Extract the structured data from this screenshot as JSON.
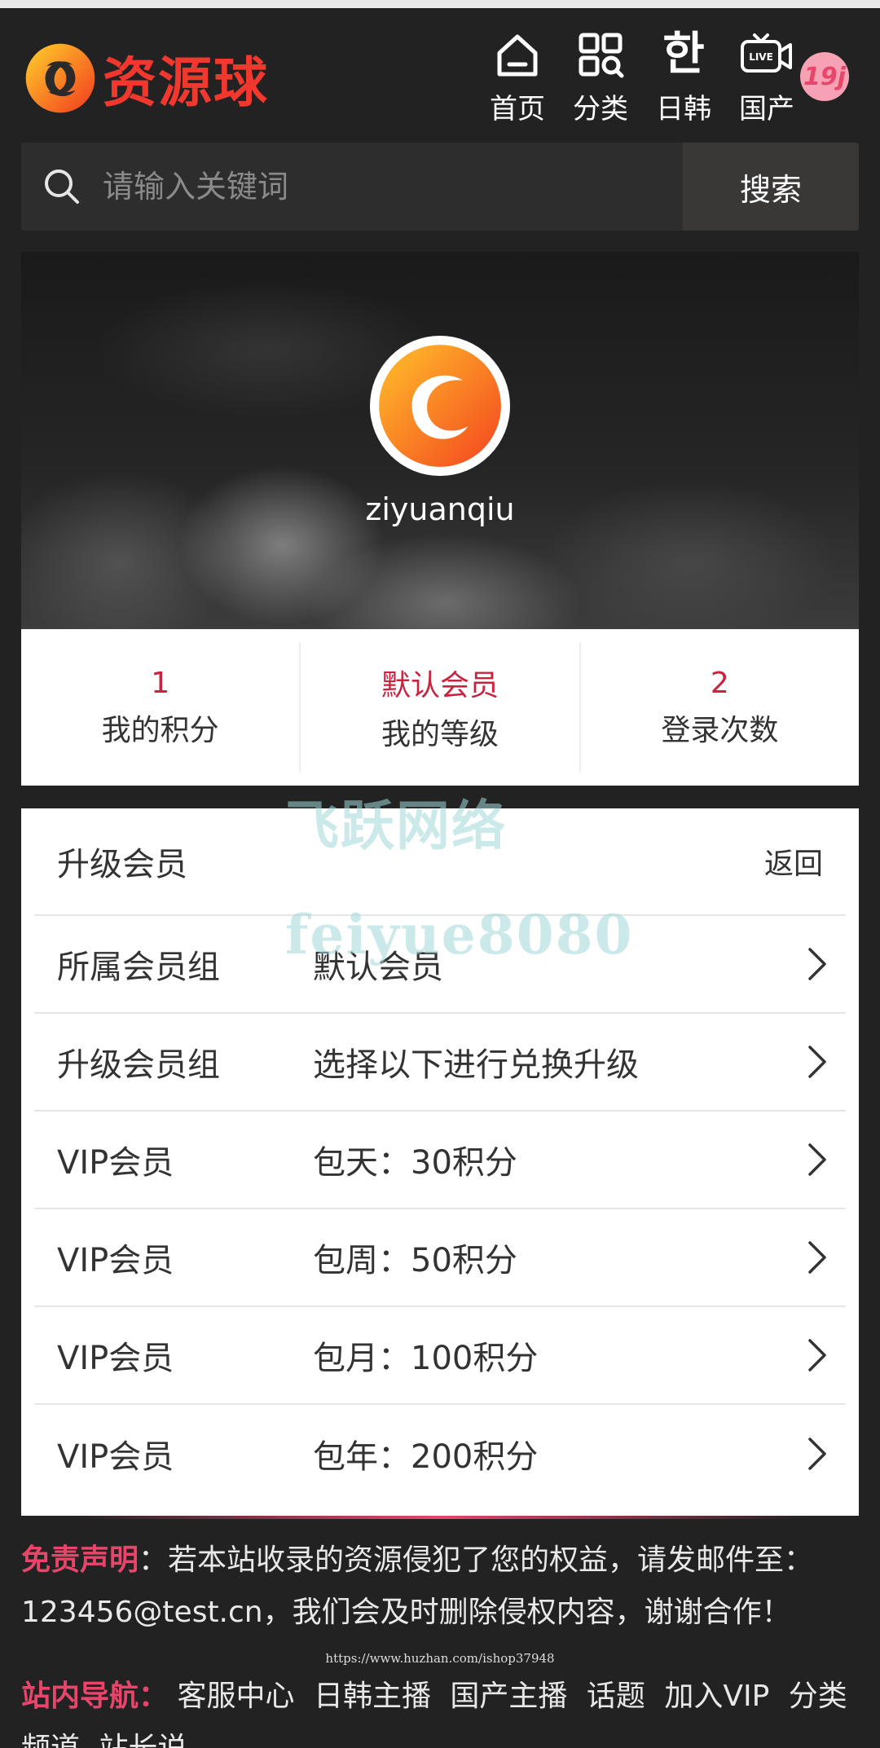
{
  "header": {
    "logo_text": "资源球",
    "nav": [
      {
        "label": "首页",
        "icon": "home-icon"
      },
      {
        "label": "分类",
        "icon": "category-icon"
      },
      {
        "label": "日韩",
        "icon": "korean-han-icon",
        "glyph": "한"
      },
      {
        "label": "国产",
        "icon": "live-camera-icon",
        "glyph": "LIVE"
      }
    ],
    "badge": "19j"
  },
  "search": {
    "placeholder": "请输入关键词",
    "button": "搜索"
  },
  "profile": {
    "username": "ziyuanqiu"
  },
  "stats": [
    {
      "value": "1",
      "label": "我的积分"
    },
    {
      "value": "默认会员",
      "label": "我的等级"
    },
    {
      "value": "2",
      "label": "登录次数"
    }
  ],
  "upgrade": {
    "title": "升级会员",
    "back": "返回",
    "rows": [
      {
        "label": "所属会员组",
        "value": "默认会员"
      },
      {
        "label": "升级会员组",
        "value": "选择以下进行兑换升级"
      },
      {
        "label": "VIP会员",
        "value": "包天：30积分"
      },
      {
        "label": "VIP会员",
        "value": "包周：50积分"
      },
      {
        "label": "VIP会员",
        "value": "包月：100积分"
      },
      {
        "label": "VIP会员",
        "value": "包年：200积分"
      }
    ]
  },
  "watermark": {
    "line1": "飞跃网络",
    "line2": "feiyue8080",
    "url": "https://www.huzhan.com/ishop37948"
  },
  "footer": {
    "disclaimer_label": "免责声明",
    "disclaimer_text": "：若本站收录的资源侵犯了您的权益，请发邮件至：123456@test.cn，我们会及时删除侵权内容，谢谢合作！",
    "nav_label": "站内导航：",
    "nav_links": [
      "客服中心",
      "日韩主播",
      "国产主播",
      "话题",
      "加入VIP",
      "分类频道",
      "站长说"
    ]
  },
  "colors": {
    "background": "#222222",
    "accent": "#e8456b",
    "stat_value": "#c8243f",
    "logo": "#f0382e"
  }
}
